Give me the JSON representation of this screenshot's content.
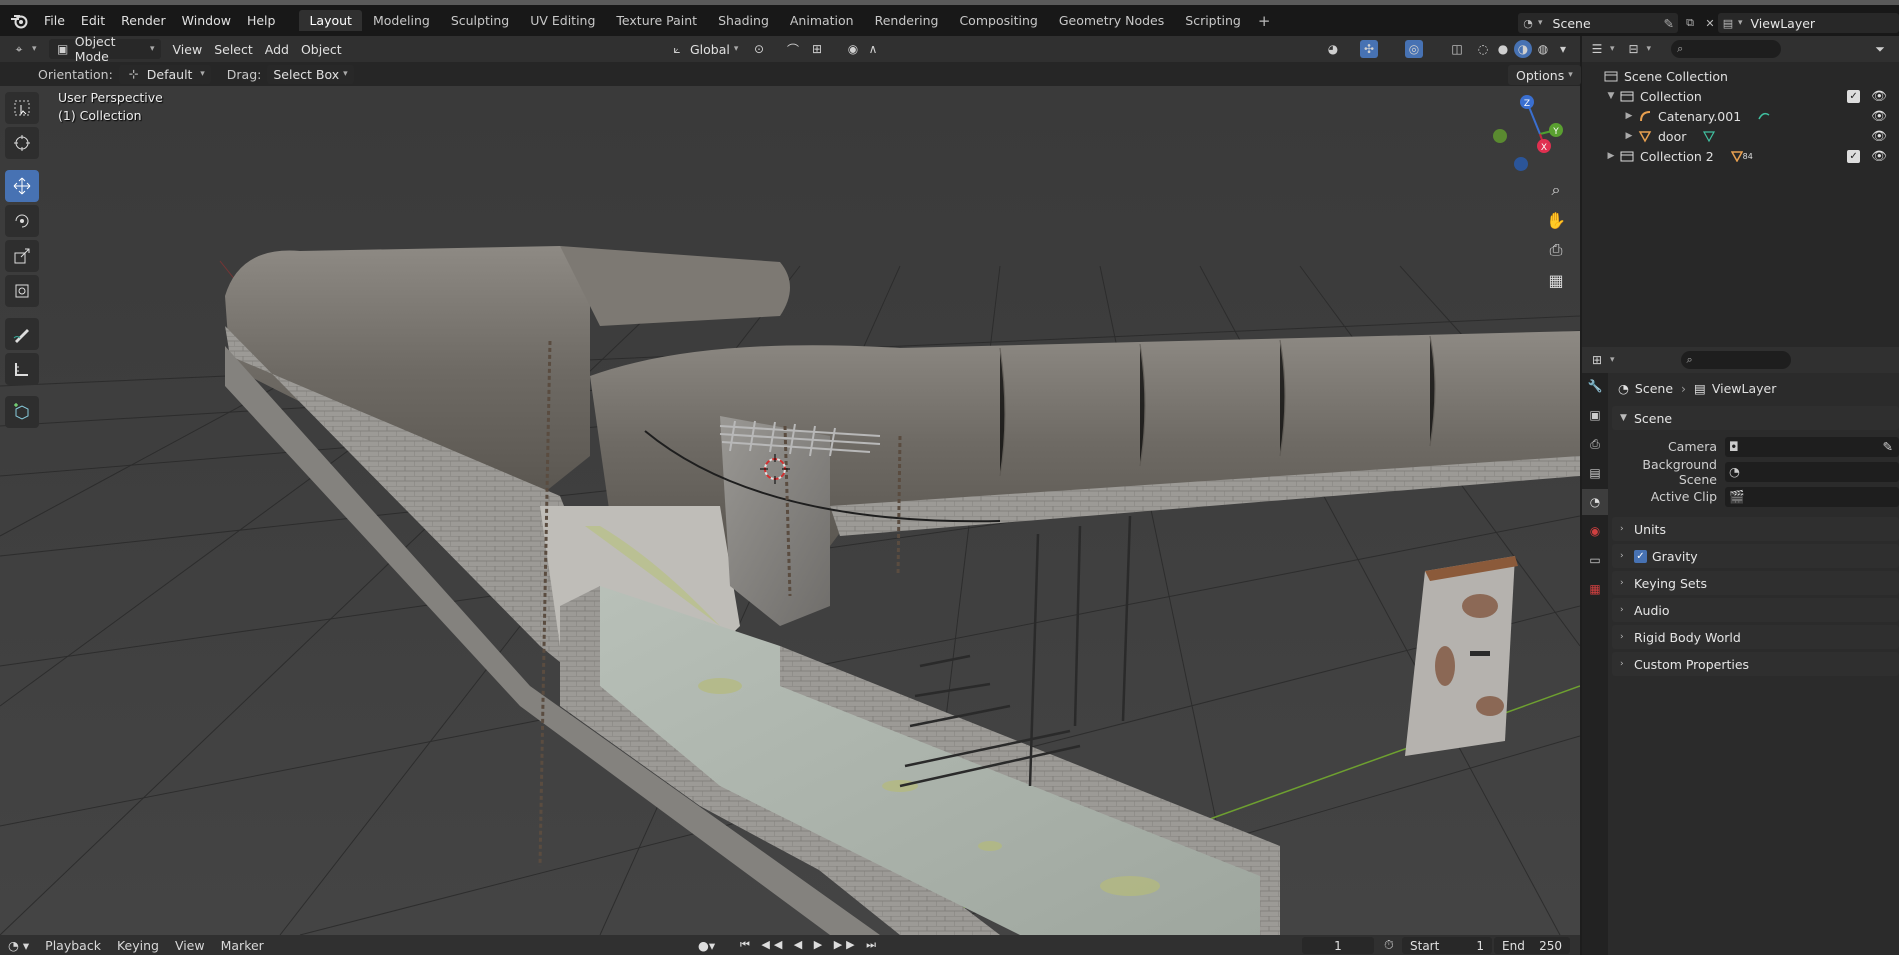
{
  "menu": [
    "File",
    "Edit",
    "Render",
    "Window",
    "Help"
  ],
  "workspaces": [
    "Layout",
    "Modeling",
    "Sculpting",
    "UV Editing",
    "Texture Paint",
    "Shading",
    "Animation",
    "Rendering",
    "Compositing",
    "Geometry Nodes",
    "Scripting"
  ],
  "active_workspace": "Layout",
  "scene_field": "Scene",
  "viewlayer_field": "ViewLayer",
  "viewport_header": {
    "mode": "Object Mode",
    "menus": [
      "View",
      "Select",
      "Add",
      "Object"
    ],
    "transform_orientation": "Global"
  },
  "tool_settings": {
    "orientation_label": "Orientation:",
    "orientation_value": "Default",
    "drag_label": "Drag:",
    "drag_value": "Select Box",
    "options_label": "Options"
  },
  "viewport": {
    "perspective_label": "User Perspective",
    "collection_label": "(1) Collection"
  },
  "outliner": {
    "scene_collection": "Scene Collection",
    "items": [
      {
        "name": "Collection",
        "level": 1
      },
      {
        "name": "Catenary.001",
        "level": 2
      },
      {
        "name": "door",
        "level": 2
      },
      {
        "name": "Collection 2",
        "level": 1,
        "badge": "84"
      }
    ]
  },
  "properties": {
    "breadcrumb_scene": "Scene",
    "breadcrumb_viewlayer": "ViewLayer",
    "scene_panel": "Scene",
    "fields": [
      {
        "label": "Camera"
      },
      {
        "label": "Background Scene"
      },
      {
        "label": "Active Clip"
      }
    ],
    "panels": [
      "Units",
      "Gravity",
      "Keying Sets",
      "Audio",
      "Rigid Body World",
      "Custom Properties"
    ],
    "gravity_checked": true
  },
  "timeline": {
    "menus": [
      "Playback",
      "Keying",
      "View",
      "Marker"
    ],
    "current_frame": "1",
    "start_label": "Start",
    "start_value": "1",
    "end_label": "End",
    "end_value": "250"
  },
  "axis_labels": {
    "x": "X",
    "y": "Y",
    "z": "Z"
  }
}
